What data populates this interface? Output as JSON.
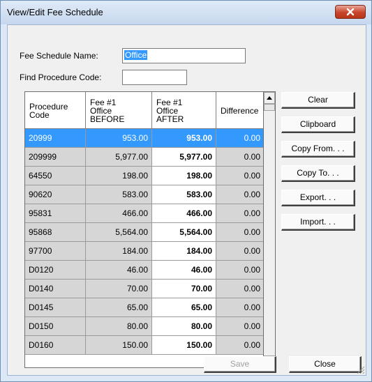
{
  "window": {
    "title": "View/Edit Fee Schedule"
  },
  "form": {
    "fee_schedule_label": "Fee Schedule Name:",
    "fee_schedule_value": "Office",
    "find_code_label": "Find Procedure Code:",
    "find_code_value": ""
  },
  "grid": {
    "headers": {
      "code": [
        "Procedure",
        "Code"
      ],
      "before": [
        "Fee #1",
        "Office",
        "BEFORE"
      ],
      "after": [
        "Fee #1",
        "Office",
        "AFTER"
      ],
      "diff": [
        "Difference"
      ]
    },
    "rows": [
      {
        "code": "20999",
        "before": "953.00",
        "after": "953.00",
        "diff": "0.00",
        "selected": true
      },
      {
        "code": "209999",
        "before": "5,977.00",
        "after": "5,977.00",
        "diff": "0.00"
      },
      {
        "code": "64550",
        "before": "198.00",
        "after": "198.00",
        "diff": "0.00"
      },
      {
        "code": "90620",
        "before": "583.00",
        "after": "583.00",
        "diff": "0.00"
      },
      {
        "code": "95831",
        "before": "466.00",
        "after": "466.00",
        "diff": "0.00"
      },
      {
        "code": "95868",
        "before": "5,564.00",
        "after": "5,564.00",
        "diff": "0.00"
      },
      {
        "code": "97700",
        "before": "184.00",
        "after": "184.00",
        "diff": "0.00"
      },
      {
        "code": "D0120",
        "before": "46.00",
        "after": "46.00",
        "diff": "0.00"
      },
      {
        "code": "D0140",
        "before": "70.00",
        "after": "70.00",
        "diff": "0.00"
      },
      {
        "code": "D0145",
        "before": "65.00",
        "after": "65.00",
        "diff": "0.00"
      },
      {
        "code": "D0150",
        "before": "80.00",
        "after": "80.00",
        "diff": "0.00"
      },
      {
        "code": "D0160",
        "before": "150.00",
        "after": "150.00",
        "diff": "0.00"
      }
    ]
  },
  "buttons": {
    "clear": "Clear",
    "clipboard": "Clipboard",
    "copy_from": "Copy From. . .",
    "copy_to": "Copy To. . .",
    "export": "Export. . .",
    "import": "Import. . .",
    "save": "Save",
    "close": "Close"
  },
  "colors": {
    "selection": "#3399ff",
    "close_button": "#c8452c",
    "frame": "#dce8f5"
  }
}
